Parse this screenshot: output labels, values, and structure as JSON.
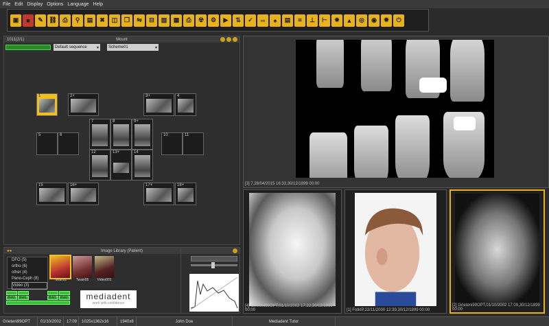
{
  "menu": [
    "File",
    "Edit",
    "Display",
    "Options",
    "Language",
    "Help"
  ],
  "mount": {
    "title": "Mount",
    "id": "1011(2/1)",
    "sequence": "Default sequence",
    "scheme": "Scheme01",
    "slots": [
      "1",
      "2+",
      "3+",
      "4",
      "5",
      "6",
      "7",
      "8",
      "9+",
      "10",
      "11",
      "12",
      "13+",
      "14",
      "15",
      "16+",
      "17+",
      "18+"
    ]
  },
  "viewer": {
    "caption": "[3] 7,28/04/2015 16:33,30/12/1899 00:00"
  },
  "thumbs": [
    {
      "caption": "[4] Grieteni99OPT,01/10/2002 17:22,30/12/1899 00:00"
    },
    {
      "caption": "[1] FotkIP,22/11/2000 12:39,30/12/1899 00:00"
    },
    {
      "caption": "[2] Grieteni99OPT,01/10/2002 17:09,30/12/1899 00:00"
    }
  ],
  "library": {
    "title": "Image Library (Patient)",
    "tree": [
      "DFO (5)",
      "ortho (6)",
      "other (4)",
      "Pano-Ceph (8)",
      "Video (3)"
    ],
    "videos": [
      "Twain02",
      "Twain05",
      "Video001"
    ],
    "bw": [
      "BW2",
      "BW1",
      "BW1",
      "BW2"
    ],
    "logo": "mediadent",
    "logo_tag": "work with confidence"
  },
  "status": {
    "file": "Grieteni99OPT",
    "date": "01/10/2002",
    "time": "17:09",
    "dims": "1025x1362x16",
    "res": "1940x8",
    "user": "John Doe",
    "app": "Mediadent Tutor"
  }
}
